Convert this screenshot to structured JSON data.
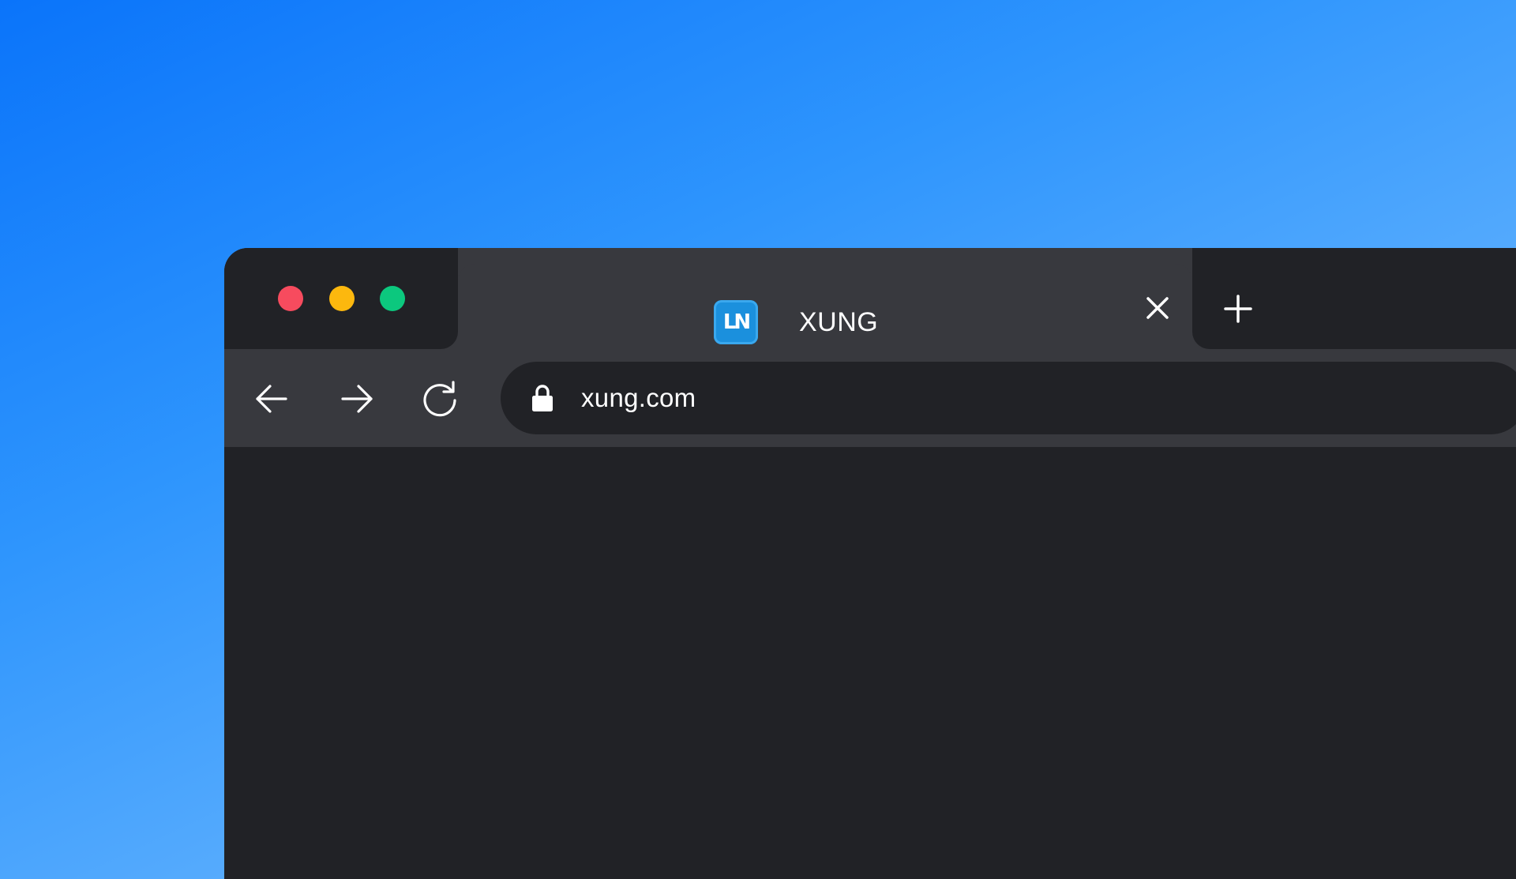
{
  "window": {
    "traffic_lights": {
      "close_color": "#f74b5e",
      "minimize_color": "#fcb80e",
      "zoom_color": "#0cc87e"
    }
  },
  "tab": {
    "favicon_text": "LN",
    "favicon_color": "#1b90dd",
    "title": "XUNG",
    "close_icon": "close-icon"
  },
  "new_tab": {
    "icon": "plus-icon"
  },
  "toolbar": {
    "back_icon": "arrow-left-icon",
    "forward_icon": "arrow-right-icon",
    "reload_icon": "reload-icon"
  },
  "address_bar": {
    "lock_icon": "lock-icon",
    "url": "xung.com"
  },
  "colors": {
    "chrome_dark": "#212226",
    "chrome_light": "#38393e",
    "text": "#ffffff"
  }
}
